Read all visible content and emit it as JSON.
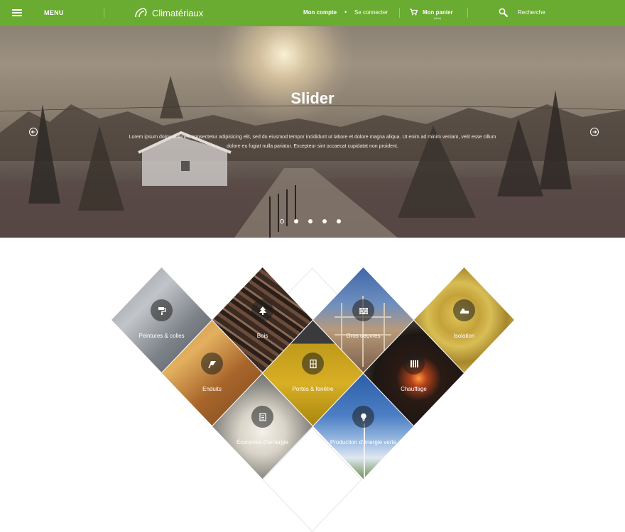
{
  "topbar": {
    "menu_label": "MENU",
    "logo_text": "Climatériaux",
    "account": "Mon compte",
    "separator": "•",
    "login": "Se connecter",
    "cart": "Mon panier",
    "cart_sub": "(vide)",
    "search": "Recherche",
    "icons": [
      "menu-icon",
      "logo-icon",
      "cart-icon",
      "search-icon"
    ],
    "color": "#6aab31"
  },
  "hero": {
    "title": "Slider",
    "text": "Lorem ipsum dolor sit amet, consectetur adipisicing elit, sed do eiusmod tempor incididunt ut labore et dolore magna aliqua. Ut enim ad minim veniam, velit esse cillum dolore eu fugiat nulla pariatur. Excepteur sint occaecat cupidatat non proident.",
    "slide_count": 5,
    "active_slide": 1
  },
  "categories": [
    {
      "label": "Peintures & colles",
      "icon": "paint-roller-icon"
    },
    {
      "label": "Bois",
      "icon": "tree-icon"
    },
    {
      "label": "Gros oeuvres",
      "icon": "brick-wall-icon"
    },
    {
      "label": "Isolation",
      "icon": "insulation-roll-icon"
    },
    {
      "label": "Enduits",
      "icon": "trowel-icon"
    },
    {
      "label": "Portes & fenêtre",
      "icon": "window-icon"
    },
    {
      "label": "Chauffage",
      "icon": "radiator-icon"
    },
    {
      "label": "Économie d'ernergie",
      "icon": "energy-meter-icon"
    },
    {
      "label": "Production d'énergie verte",
      "icon": "lightbulb-icon"
    }
  ]
}
